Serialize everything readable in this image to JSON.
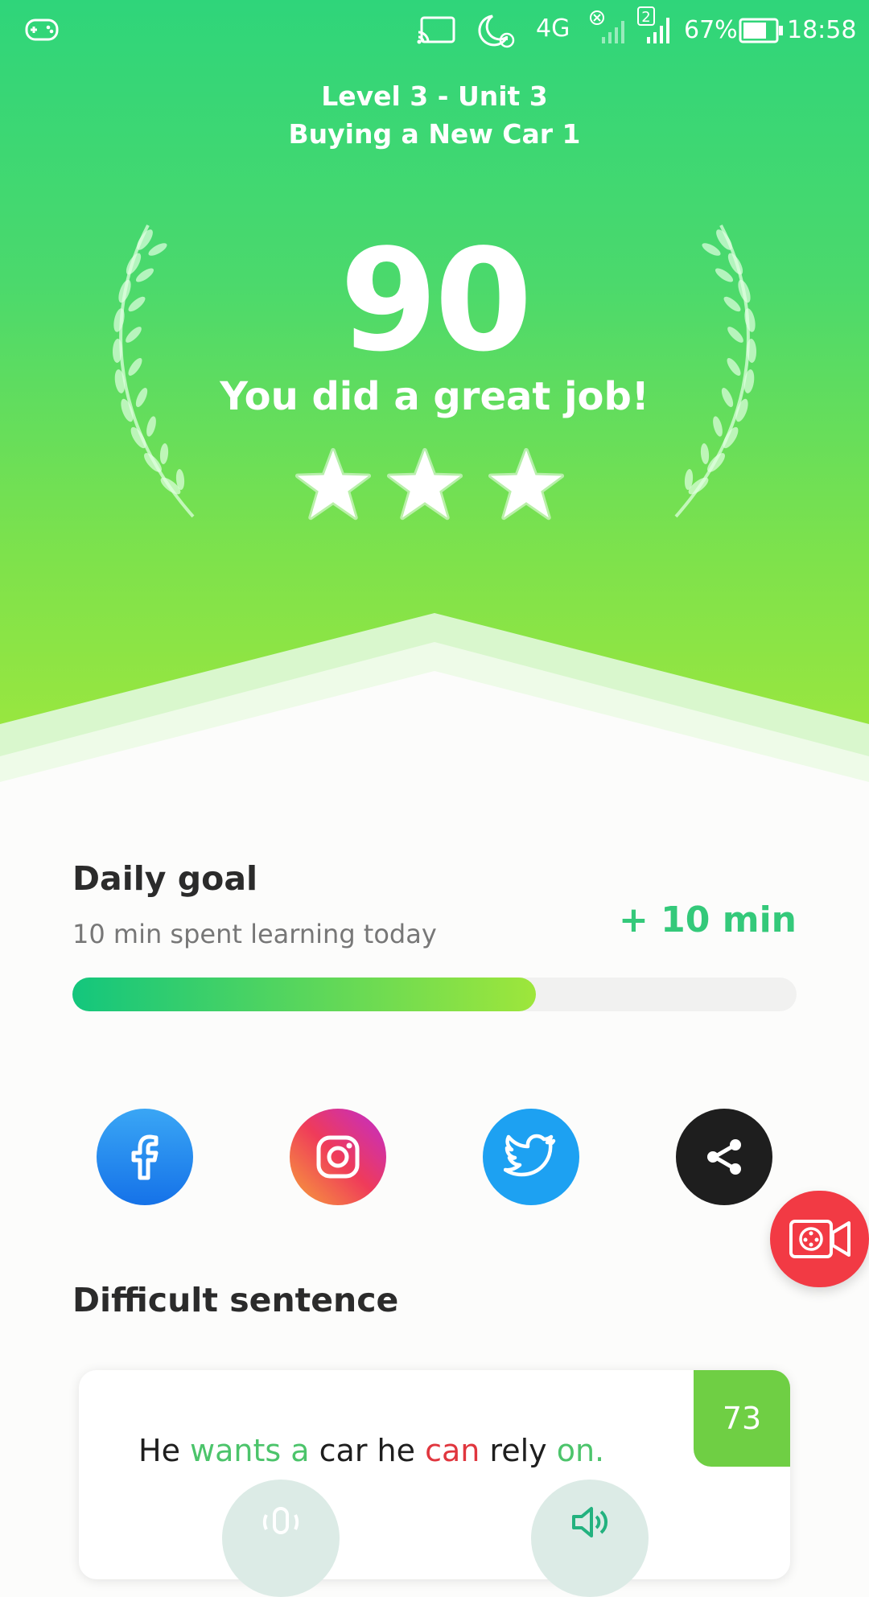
{
  "status_bar": {
    "gamepad_icon": "gamepad-icon",
    "network": "4G",
    "sim2": "2",
    "battery": "67%",
    "time": "18:58"
  },
  "lesson": {
    "line1": "Level 3 - Unit 3",
    "line2": "Buying a New Car 1"
  },
  "result": {
    "score": "90",
    "message": "You did a great job!",
    "stars_earned": 3,
    "stars_total": 3
  },
  "daily_goal": {
    "title": "Daily goal",
    "subtitle": "10 min spent learning today",
    "gain": "+ 10 min",
    "progress": 0.64
  },
  "share": {
    "icons": [
      "facebook-icon",
      "instagram-icon",
      "twitter-icon",
      "share-icon"
    ]
  },
  "record_button_icon": "video-record-icon",
  "difficult": {
    "title": "Difficult sentence",
    "score": "73",
    "words": [
      {
        "text": "He ",
        "state": "normal"
      },
      {
        "text": "wants a",
        "state": "good"
      },
      {
        "text": " car he ",
        "state": "normal"
      },
      {
        "text": "can",
        "state": "bad"
      },
      {
        "text": " rely ",
        "state": "normal"
      },
      {
        "text": "on.",
        "state": "good"
      }
    ]
  },
  "colors": {
    "accent": "#34c97a",
    "good": "#4cc46b",
    "bad": "#e0363e",
    "badge": "#6fcf44",
    "record": "#f23a44"
  }
}
